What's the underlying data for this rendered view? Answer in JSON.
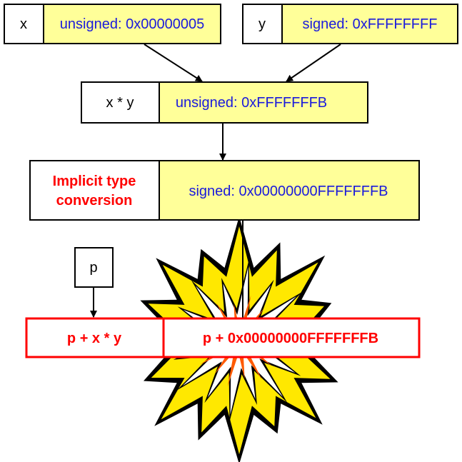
{
  "colors": {
    "value_fill": "#ffff99",
    "value_text": "#1a1adc",
    "highlight": "#ff0000",
    "explosion_outer": "#ffe800",
    "explosion_inner": "#ff5a00"
  },
  "x_box": {
    "label": "x",
    "value": "unsigned: 0x00000005"
  },
  "y_box": {
    "label": "y",
    "value": "signed: 0xFFFFFFFF"
  },
  "product_box": {
    "label": "x * y",
    "value": "unsigned: 0xFFFFFFFB"
  },
  "conversion_box": {
    "label_line1": "Implicit type",
    "label_line2": "conversion",
    "value": "signed: 0x00000000FFFFFFFB"
  },
  "p_box": {
    "label": "p"
  },
  "result_box": {
    "label": "p + x * y",
    "value": "p +  0x00000000FFFFFFFB"
  },
  "decoration": {
    "icon": "explosion-icon"
  }
}
